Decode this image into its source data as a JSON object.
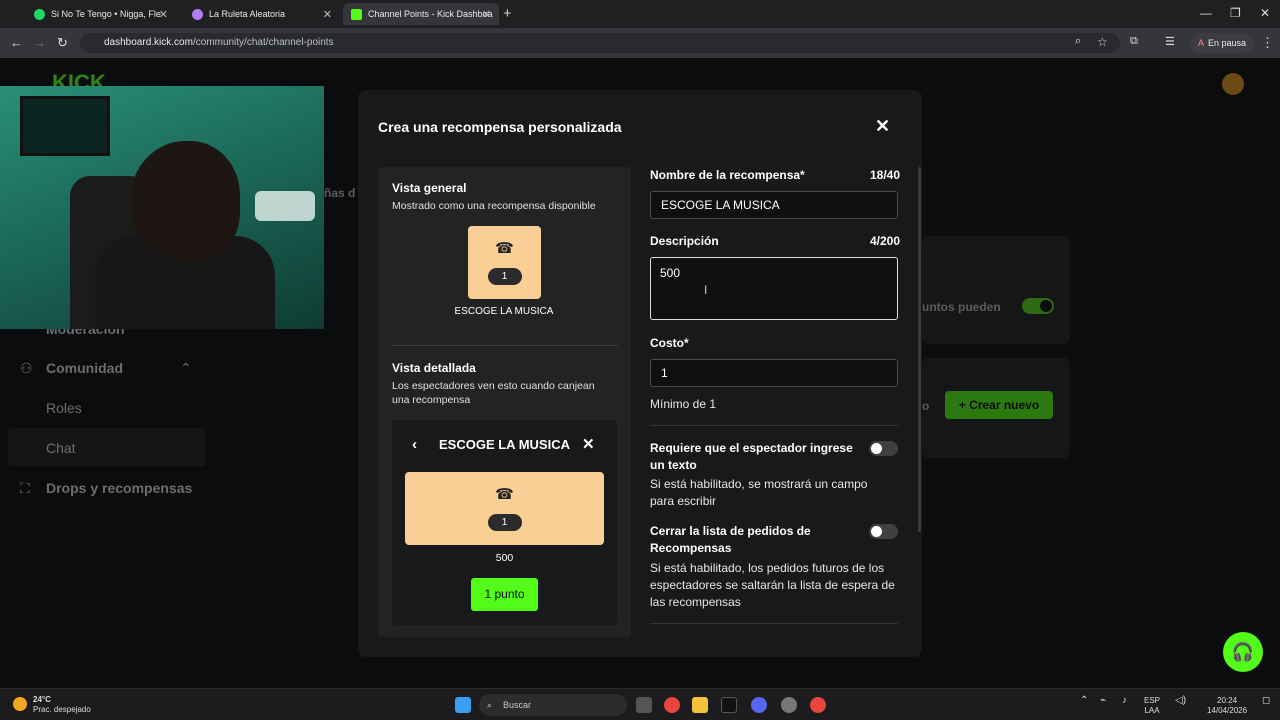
{
  "browser": {
    "tabs": [
      {
        "title": "Si No Te Tengo • Nigga, Fle",
        "color": "#1ed760"
      },
      {
        "title": "La Ruleta Aleatoria",
        "color": "#b27cf5"
      },
      {
        "title": "Channel Points - Kick Dashboa",
        "color": "#53fc18"
      }
    ],
    "url_host": "dashboard.kick.com",
    "url_path": "/community/chat/channel-points",
    "profile_label": "En pausa"
  },
  "sidebar": {
    "moderacion": "Moderación",
    "comunidad": "Comunidad",
    "roles": "Roles",
    "chat": "Chat",
    "drops": "Drops y recompensas"
  },
  "background": {
    "partial_label_1": "ñas d",
    "partial_label_2": "untos pueden",
    "partial_label_3": "o",
    "create_new": "Crear nuevo"
  },
  "modal": {
    "title": "Crea una recompensa personalizada",
    "preview": {
      "overview_title": "Vista general",
      "overview_sub": "Mostrado como una recompensa disponible",
      "cost": "1",
      "reward_name": "ESCOGE LA MUSICA",
      "detail_title": "Vista detallada",
      "detail_sub": "Los espectadores ven esto cuando canjean una recompensa",
      "detail_desc": "500",
      "detail_button": "1 punto"
    },
    "form": {
      "name_label": "Nombre de la recompensa*",
      "name_count": "18/40",
      "name_value": "ESCOGE LA MUSICA",
      "desc_label": "Descripción",
      "desc_count": "4/200",
      "desc_value": "500",
      "cost_label": "Costo*",
      "cost_value": "1",
      "cost_hint": "Mínimo de 1",
      "require_text_label": "Requiere que el espectador ingrese un texto",
      "require_text_sub": "Si está habilitado, se mostrará un campo para escribir",
      "close_queue_label": "Cerrar la lista de pedidos de Recompensas",
      "close_queue_sub": "Si está habilitado, los pedidos futuros de los espectadores se saltarán la lista de espera de las recompensas"
    }
  },
  "taskbar": {
    "temp": "24°C",
    "weather": "Prac. despejado",
    "search": "Buscar",
    "lang1": "ESP",
    "lang2": "LAA",
    "time": "20:24",
    "date": "14/04/2026"
  }
}
